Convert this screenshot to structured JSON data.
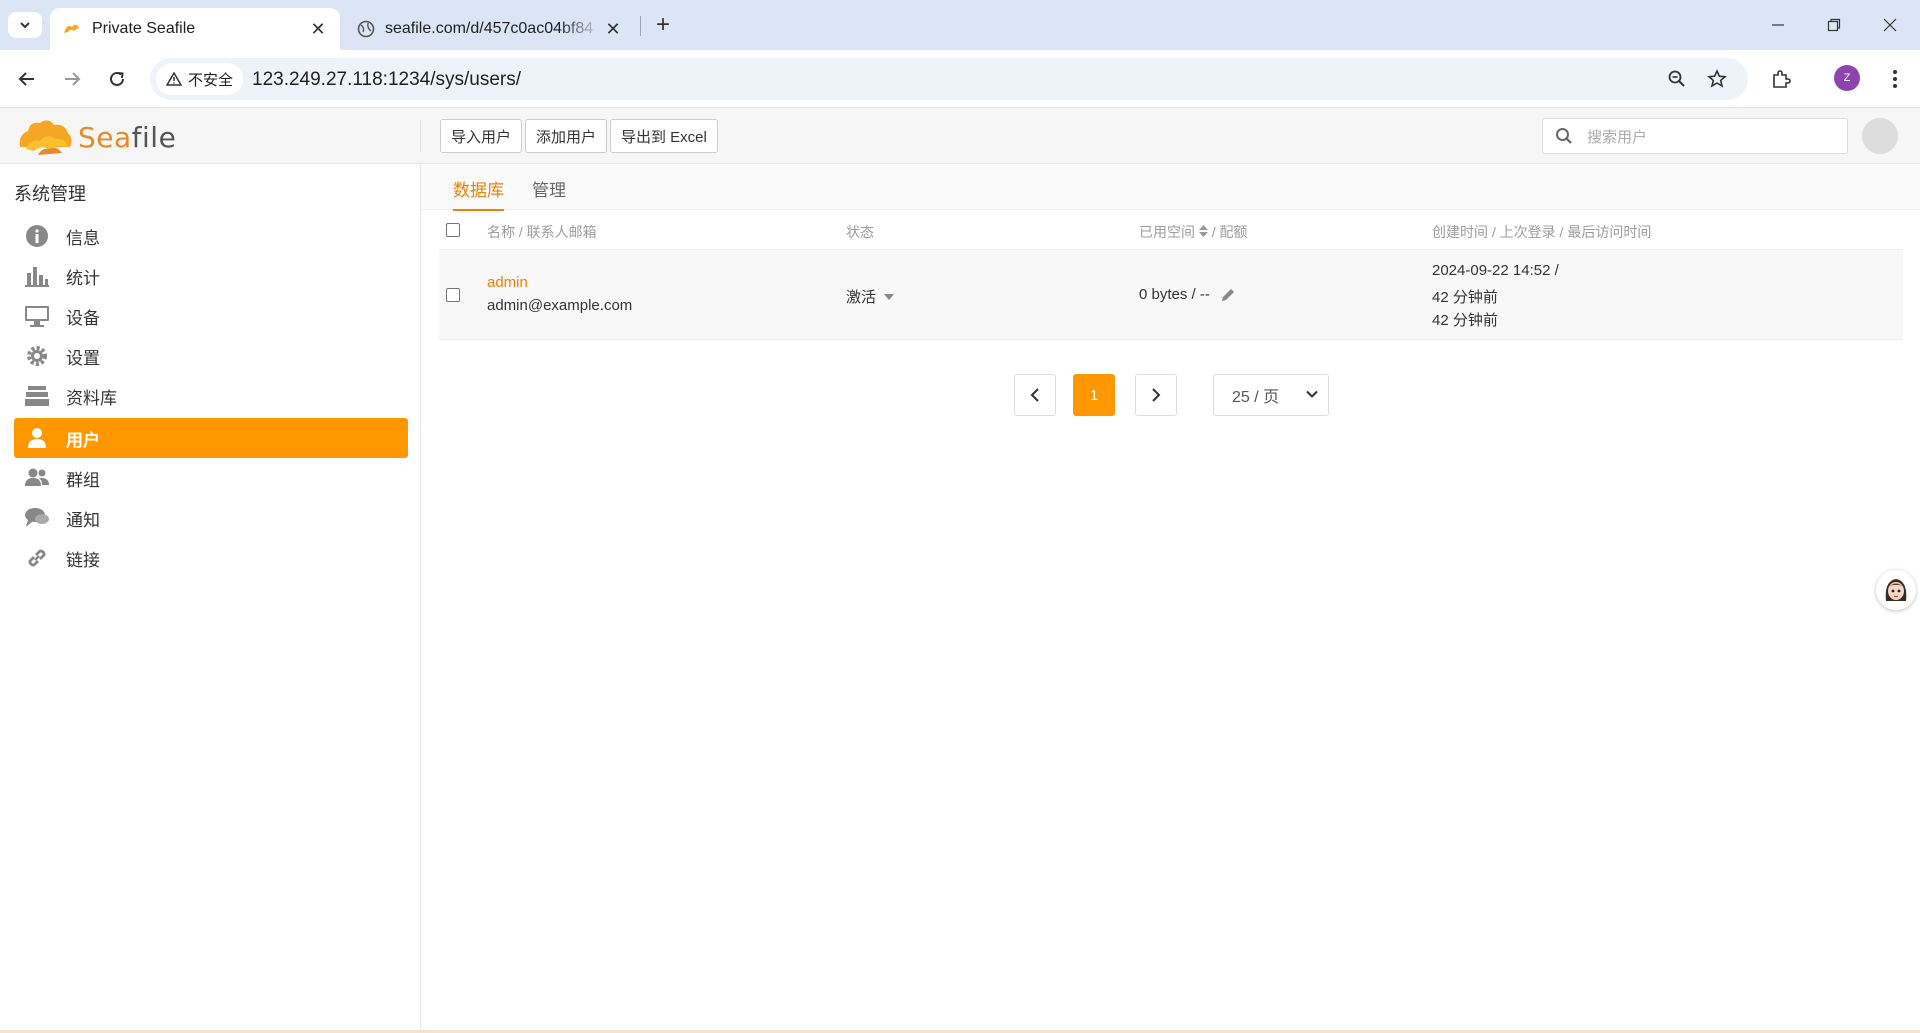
{
  "browser": {
    "tabs": [
      {
        "title": "Private Seafile",
        "active": true
      },
      {
        "title": "seafile.com/d/457c0ac04bf84",
        "active": false
      }
    ],
    "security_label": "不安全",
    "url": "123.249.27.118:1234/sys/users/",
    "profile_initial": "Z"
  },
  "app": {
    "logo_text_a": "Sea",
    "logo_text_b": "file",
    "header_buttons": {
      "import": "导入用户",
      "add": "添加用户",
      "export": "导出到 Excel"
    },
    "search_placeholder": "搜索用户"
  },
  "sidebar": {
    "heading": "系统管理",
    "items": [
      {
        "label": "信息",
        "icon": "info-icon"
      },
      {
        "label": "统计",
        "icon": "bar-chart-icon"
      },
      {
        "label": "设备",
        "icon": "monitor-icon"
      },
      {
        "label": "设置",
        "icon": "gear-icon"
      },
      {
        "label": "资料库",
        "icon": "library-icon"
      },
      {
        "label": "用户",
        "icon": "user-icon",
        "active": true
      },
      {
        "label": "群组",
        "icon": "group-icon"
      },
      {
        "label": "通知",
        "icon": "chat-bubbles-icon"
      },
      {
        "label": "链接",
        "icon": "link-icon"
      }
    ]
  },
  "main": {
    "tabs": [
      {
        "label": "数据库",
        "active": true
      },
      {
        "label": "管理",
        "active": false
      }
    ],
    "columns": {
      "name": "名称 / 联系人邮箱",
      "status": "状态",
      "space": "已用空间",
      "quota": "/ 配额",
      "time": "创建时间 / 上次登录 / 最后访问时间"
    },
    "rows": [
      {
        "name": "admin",
        "email": "admin@example.com",
        "status": "激活",
        "space": "0 bytes / --",
        "created": "2024-09-22 14:52 /",
        "last_login": "42 分钟前",
        "last_access": "42 分钟前"
      }
    ],
    "pagination": {
      "current_page": "1",
      "per_page": "25 / 页"
    }
  },
  "colors": {
    "accent": "#ff9800",
    "link": "#eb8205"
  }
}
